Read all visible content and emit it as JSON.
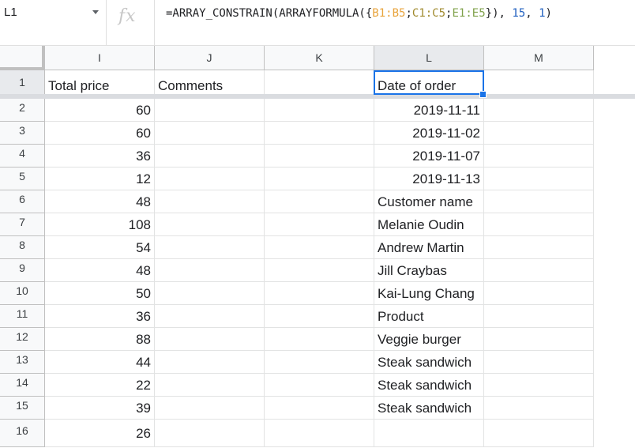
{
  "formula_bar": {
    "cell_ref": "L1",
    "fx_label": "fx",
    "formula": {
      "prefix": "=ARRAY_CONSTRAIN(ARRAYFORMULA({",
      "range1": "B1:B5",
      "sep1": ";",
      "range2": "C1:C5",
      "sep2": ";",
      "range3": "E1:E5",
      "mid": "}), ",
      "arg1": "15",
      "comma": ", ",
      "arg2": "1",
      "suffix": ")"
    },
    "range_colors": [
      "#e8a33b",
      "#a08a2e",
      "#7fa14a"
    ]
  },
  "columns": [
    "I",
    "J",
    "K",
    "L",
    "M"
  ],
  "selected_column": "L",
  "selected_cell": "L1",
  "rows": [
    {
      "n": "1",
      "I": "Total price",
      "J": "Comments",
      "K": "",
      "L": "Date of order",
      "M": ""
    },
    {
      "n": "2",
      "I": "60",
      "J": "",
      "K": "",
      "L": "2019-11-11",
      "M": ""
    },
    {
      "n": "3",
      "I": "60",
      "J": "",
      "K": "",
      "L": "2019-11-02",
      "M": ""
    },
    {
      "n": "4",
      "I": "36",
      "J": "",
      "K": "",
      "L": "2019-11-07",
      "M": ""
    },
    {
      "n": "5",
      "I": "12",
      "J": "",
      "K": "",
      "L": "2019-11-13",
      "M": ""
    },
    {
      "n": "6",
      "I": "48",
      "J": "",
      "K": "",
      "L": "Customer name",
      "M": ""
    },
    {
      "n": "7",
      "I": "108",
      "J": "",
      "K": "",
      "L": "Melanie Oudin",
      "M": ""
    },
    {
      "n": "8",
      "I": "54",
      "J": "",
      "K": "",
      "L": "Andrew Martin",
      "M": ""
    },
    {
      "n": "9",
      "I": "48",
      "J": "",
      "K": "",
      "L": "Jill Craybas",
      "M": ""
    },
    {
      "n": "10",
      "I": "50",
      "J": "",
      "K": "",
      "L": "Kai-Lung Chang",
      "M": ""
    },
    {
      "n": "11",
      "I": "36",
      "J": "",
      "K": "",
      "L": "Product",
      "M": ""
    },
    {
      "n": "12",
      "I": "88",
      "J": "",
      "K": "",
      "L": "Veggie burger",
      "M": ""
    },
    {
      "n": "13",
      "I": "44",
      "J": "",
      "K": "",
      "L": "Steak sandwich",
      "M": ""
    },
    {
      "n": "14",
      "I": "22",
      "J": "",
      "K": "",
      "L": "Steak sandwich",
      "M": ""
    },
    {
      "n": "15",
      "I": "39",
      "J": "",
      "K": "",
      "L": "Steak sandwich",
      "M": ""
    },
    {
      "n": "16",
      "I": "26",
      "J": "",
      "K": "",
      "L": "",
      "M": ""
    }
  ]
}
